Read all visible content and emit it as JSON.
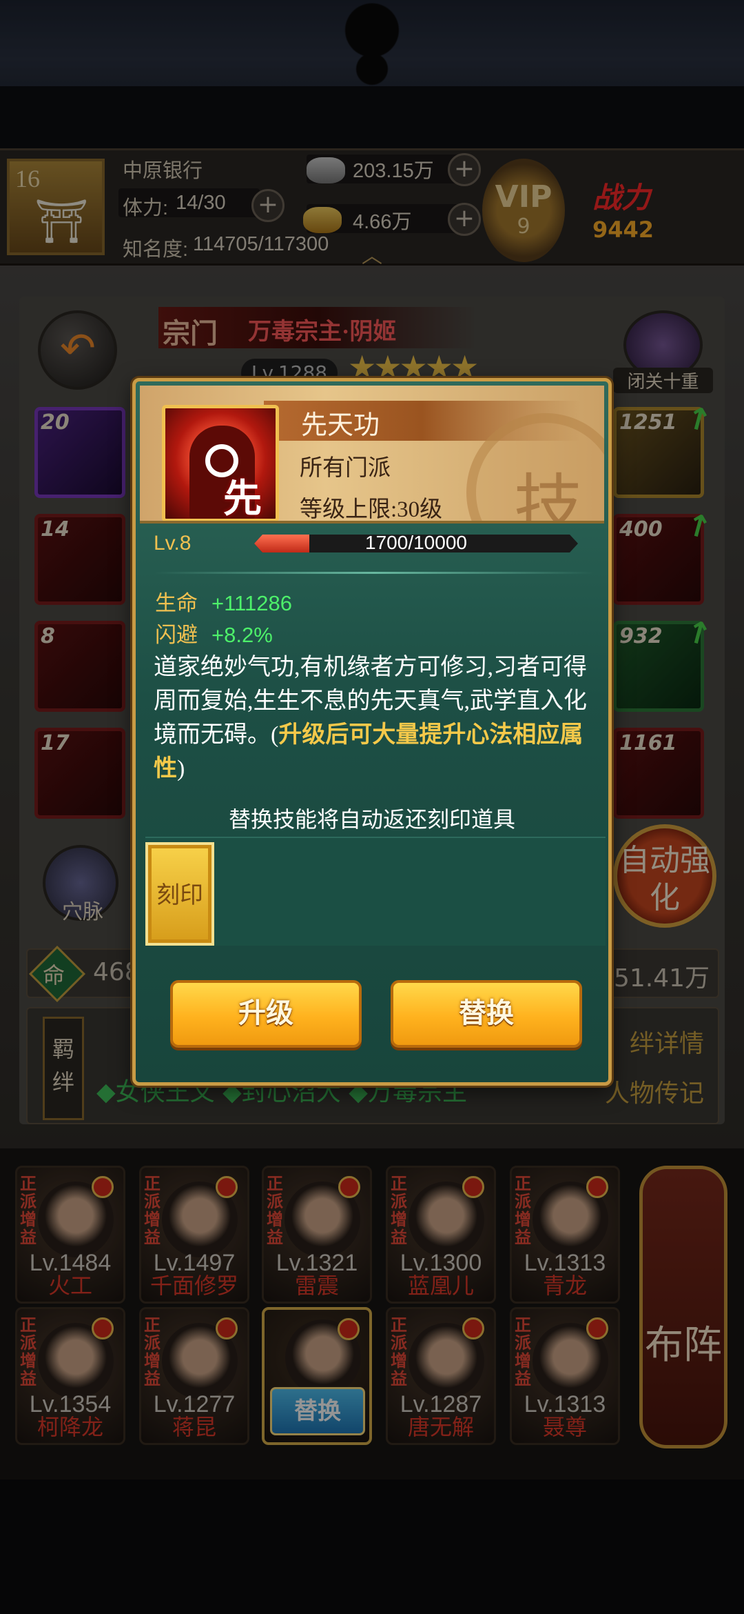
{
  "topbar": {
    "level": "16",
    "guild": "中原银行",
    "stamina_label": "体力:",
    "stamina_value": "14/30",
    "fame_label": "知名度:",
    "fame_value": "114705/117300",
    "silver": "203.15万",
    "gold": "4.66万",
    "vip_label": "VIP",
    "vip_level": "9",
    "power_label": "战力",
    "power_value": "9442"
  },
  "hero": {
    "title_tag": "宗门",
    "name": "万毒宗主·阴姬",
    "level": "Lv.1288",
    "star_count": 5,
    "right_label": "闭关十重",
    "left_slots": [
      "20",
      "14",
      "8",
      "17"
    ],
    "right_slots": [
      "1251",
      "400",
      "932",
      "1161"
    ],
    "meridian_label": "穴脉",
    "auto_strengthen": "自动强化",
    "strip_left": "468",
    "strip_right": "51.41万",
    "bond_tag": "羁绊",
    "bond_detail": "绊详情",
    "bond_biography": "人物传记",
    "bond_row": "◆女侠王文 ◆封心沼大 ◆万毒宗主"
  },
  "modal": {
    "skill_name": "先天功",
    "skill_char": "先",
    "emblem_char": "技",
    "school": "所有门派",
    "level_cap": "等级上限:30级",
    "level": "Lv.8",
    "exp_text": "1700/10000",
    "exp_current": 1700,
    "exp_max": 10000,
    "stat1_key": "生命",
    "stat1_value": "+111286",
    "stat2_key": "闪避",
    "stat2_value": "+8.2%",
    "desc_main": "道家绝妙气功,有机缘者方可修习,习者可得周而复始,生生不息的先天真气,武学直入化境而无碍。(",
    "desc_highlight": "升级后可大量提升心法相应属性",
    "desc_close": ")",
    "notice": "替换技能将自动返还刻印道具",
    "seal_label": "刻印",
    "upgrade_button": "升级",
    "replace_button": "替换"
  },
  "roster": {
    "cards": [
      {
        "tag": "正派增益",
        "level": "Lv.1484",
        "name": "火工"
      },
      {
        "tag": "正派增益",
        "level": "Lv.1497",
        "name": "千面修罗"
      },
      {
        "tag": "正派增益",
        "level": "Lv.1321",
        "name": "雷震"
      },
      {
        "tag": "正派增益",
        "level": "Lv.1300",
        "name": "蓝凰儿"
      },
      {
        "tag": "正派增益",
        "level": "Lv.1313",
        "name": "青龙"
      },
      {
        "tag": "正派增益",
        "level": "Lv.1354",
        "name": "柯降龙"
      },
      {
        "tag": "正派增益",
        "level": "Lv.1277",
        "name": "蒋昆"
      },
      {
        "tag": "正派增益",
        "level": "Lv.1287",
        "name": "唐无解"
      },
      {
        "tag": "正派增益",
        "level": "Lv.1313",
        "name": "聂尊"
      }
    ],
    "swap_button": "替换",
    "formation_button": "布阵"
  },
  "colors": {
    "modal_bg": "#1d4f45",
    "gold_accent": "#f0c050",
    "stat_green": "#4df06a",
    "highlight_yellow": "#f5c94a"
  }
}
